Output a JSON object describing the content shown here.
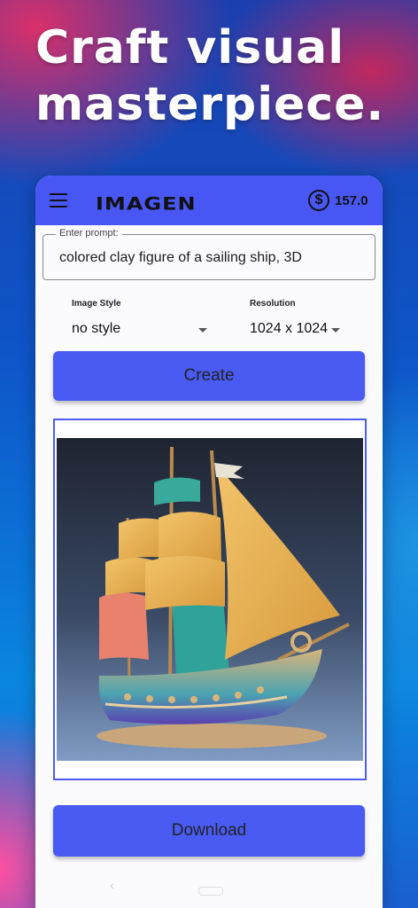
{
  "promo": {
    "headline": "Craft visual masterpiece."
  },
  "appbar": {
    "logo": "IMAGEN",
    "credits": "157.0"
  },
  "prompt": {
    "label": "Enter prompt:",
    "value": "colored clay figure of a sailing ship, 3D"
  },
  "style_select": {
    "label": "Image Style",
    "value": "no style"
  },
  "resolution_select": {
    "label": "Resolution",
    "value": "1024 x 1024"
  },
  "buttons": {
    "create": "Create",
    "download": "Download"
  },
  "colors": {
    "accent": "#4a5bf4",
    "surface": "#fbfafc"
  },
  "icons": {
    "menu": "hamburger-menu-icon",
    "credits": "dollar-coin-icon",
    "dropdown": "caret-down-icon"
  }
}
